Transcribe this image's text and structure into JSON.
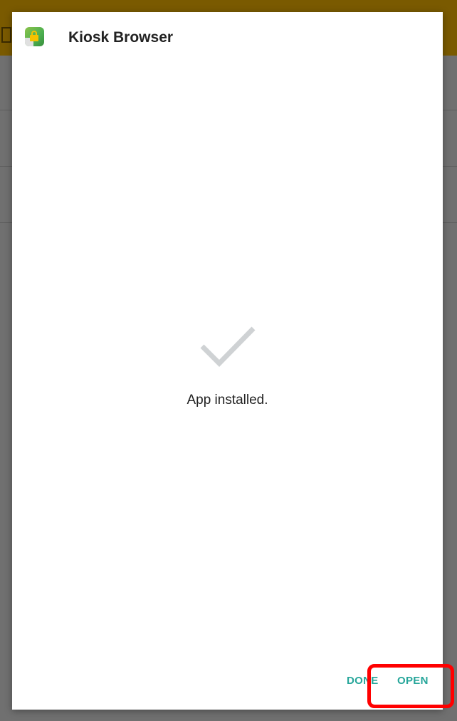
{
  "dialog": {
    "app_name": "Kiosk Browser",
    "app_icon": "kiosk-browser-lock-icon",
    "status_icon": "checkmark-icon",
    "status_text": "App installed.",
    "buttons": {
      "done_label": "DONE",
      "open_label": "OPEN"
    }
  },
  "colors": {
    "accent": "#26a69a",
    "highlight": "#ff0000",
    "checkmark": "#cfd2d4",
    "topbar": "#7a5a00"
  }
}
